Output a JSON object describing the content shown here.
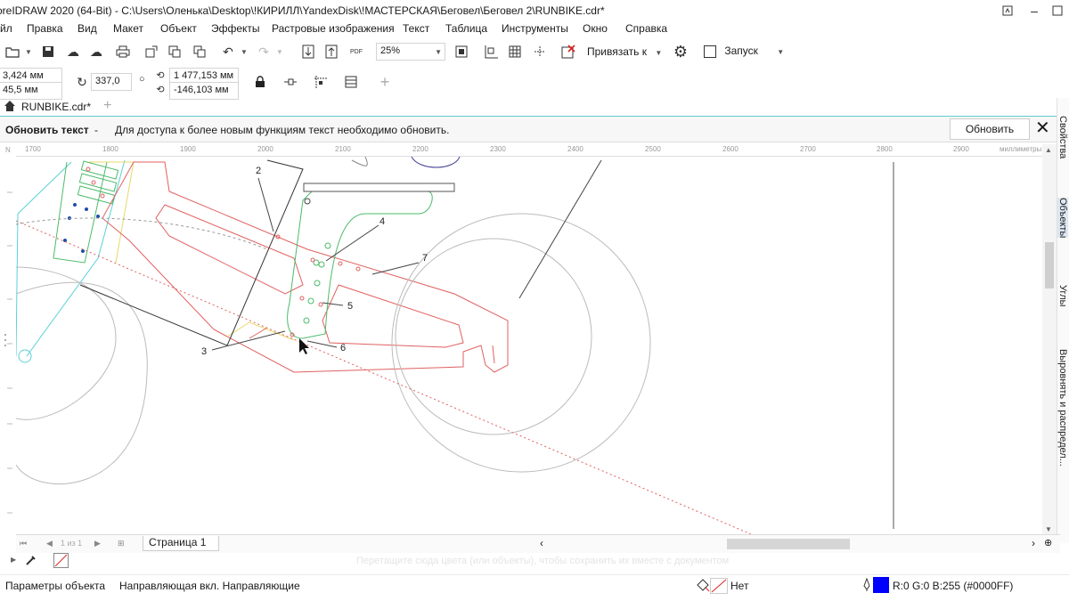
{
  "window": {
    "title": "oreIDRAW 2020 (64-Bit) - C:\\Users\\Оленька\\Desktop\\!КИРИЛЛ\\YandexDisk\\!МАСТЕРСКАЯ\\Беговел\\Беговел 2\\RUNBIKE.cdr*"
  },
  "menu": [
    "йл",
    "Правка",
    "Вид",
    "Макет",
    "Объект",
    "Эффекты",
    "Растровые изображения",
    "Текст",
    "Таблица",
    "Инструменты",
    "Окно",
    "Справка"
  ],
  "toolbar": {
    "zoom": "25%",
    "snap_label": "Привязать к",
    "launch_label": "Запуск",
    "pdf_label": "PDF"
  },
  "propbar": {
    "x": "3,424 мм",
    "y": "45,5 мм",
    "rotation": "337,0",
    "center_x": "1 477,153 мм",
    "center_y": "-146,103 мм"
  },
  "tab": {
    "label": "RUNBIKE.cdr*"
  },
  "notification": {
    "title": "Обновить текст",
    "separator": "-",
    "message": "Для доступа к более новым функциям текст необходимо обновить.",
    "button": "Обновить"
  },
  "ruler": {
    "ticks": [
      "1700",
      "1800",
      "1900",
      "2000",
      "2100",
      "2200",
      "2300",
      "2400",
      "2500",
      "2600",
      "2700",
      "2800",
      "2900"
    ],
    "unit": "миллиметры",
    "corner": "N"
  },
  "drawing": {
    "callouts": [
      "2",
      "3",
      "4",
      "5",
      "6",
      "7"
    ]
  },
  "right_dock": {
    "tabs": [
      "Свойства",
      "Объекты",
      "Углы",
      "Выровнять и распредел..."
    ]
  },
  "page_tabs": {
    "nav": "1 из 1",
    "page_label": "Страница 1"
  },
  "palette": {
    "hint": "Перетащите сюда цвета (или объекты), чтобы сохранить их вместе с документом"
  },
  "status": {
    "left": "Параметры объекта",
    "middle": "Направляющая вкл. Направляющие",
    "fill_label": "Нет",
    "outline_color_text": "R:0 G:0 B:255 (#0000FF)",
    "outline_color": "#0000FF"
  },
  "colors": {
    "accent": "#5fc9d1",
    "red_outline": "#e06060",
    "green_outline": "#4cbb6a",
    "cyan_outline": "#5cd0d8"
  }
}
